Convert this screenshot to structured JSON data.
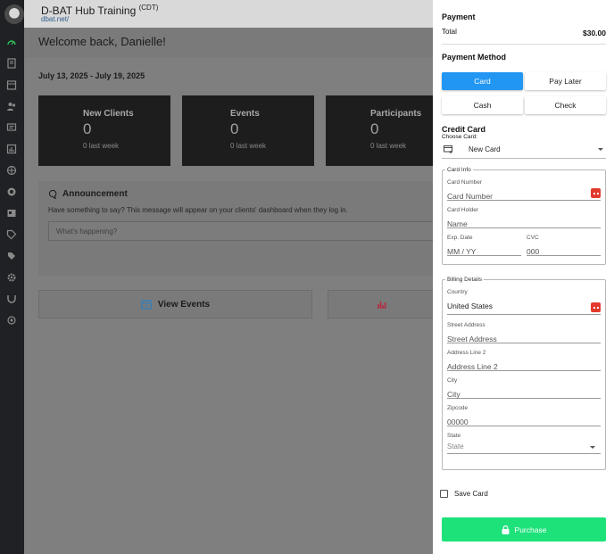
{
  "app": {
    "title": "D-BAT Hub Training",
    "timezone": "(CDT)",
    "url": "dbat.net/"
  },
  "nav_icons": [
    "speedometer-icon",
    "book-icon",
    "calendar-icon",
    "people-icon",
    "chat-icon",
    "chart-icon",
    "globe-icon",
    "hand-coin-icon",
    "id-card-icon",
    "tag-icon",
    "tags-icon",
    "gear-icon",
    "d-bat-icon",
    "palette-icon"
  ],
  "dashboard": {
    "welcome": "Welcome back, Danielle!",
    "date_range": "July 13, 2025 - July 19, 2025",
    "stats": [
      {
        "label": "New Clients",
        "value": "0",
        "sub": "0 last week"
      },
      {
        "label": "Events",
        "value": "0",
        "sub": "0 last week"
      },
      {
        "label": "Participants",
        "value": "0",
        "sub": "0 last week"
      }
    ],
    "announcement": {
      "title": "Announcement",
      "description": "Have something to say? This message will appear on your clients' dashboard when they log in.",
      "placeholder": "What's happening?"
    },
    "actions": {
      "view_events": "View Events"
    }
  },
  "payment": {
    "heading": "Payment",
    "total_label": "Total",
    "total_value": "$30.00",
    "method_heading": "Payment Method",
    "methods": [
      "Card",
      "Pay Later",
      "Cash",
      "Check"
    ],
    "selected_method": "Card",
    "credit_card": {
      "heading": "Credit Card",
      "choose_label": "Choose Card:",
      "selected_card": "New Card"
    },
    "card_info": {
      "legend": "Card Info",
      "card_number_label": "Card Number",
      "card_number_placeholder": "Card Number",
      "card_holder_label": "Card Holder",
      "card_holder_placeholder": "Name",
      "exp_label": "Exp. Date",
      "exp_placeholder": "MM / YY",
      "cvc_label": "CVC",
      "cvc_placeholder": "000"
    },
    "billing": {
      "legend": "Billing Details",
      "country_label": "Country",
      "country_value": "United States",
      "street_label": "Street Address",
      "street_placeholder": "Street Address",
      "address2_label": "Address Line 2",
      "address2_placeholder": "Address Line 2",
      "city_label": "City",
      "city_placeholder": "City",
      "zip_label": "Zipcode",
      "zip_placeholder": "00000",
      "state_label": "State",
      "state_placeholder": "State"
    },
    "save_card_label": "Save Card",
    "save_card_checked": false,
    "purchase_label": "Purchase",
    "colors": {
      "accent": "#2196f3",
      "purchase": "#1de27a",
      "autofill_icon": "#e23b2e"
    }
  }
}
